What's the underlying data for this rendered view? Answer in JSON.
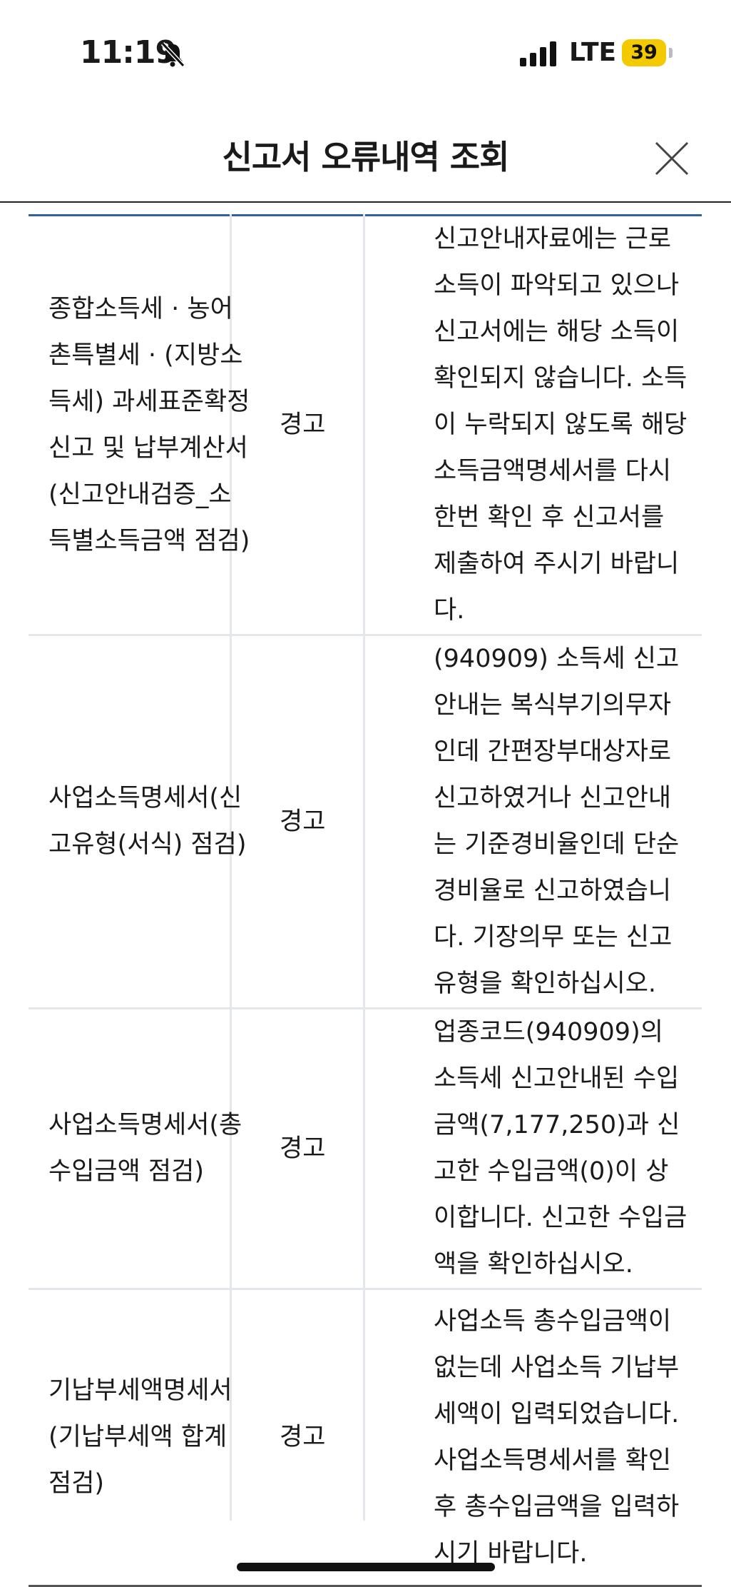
{
  "status_bar": {
    "time": "11:19",
    "network": "LTE",
    "battery": "39"
  },
  "header": {
    "title": "신고서 오류내역 조회"
  },
  "rows": [
    {
      "name": "종합소득세 · 농어촌특별세 · (지방소득세) 과세표준확정 신고 및 납부계산서(신고안내검증_소득별소득금액 점검)",
      "level": "경고",
      "message": "신고안내자료에는 근로소득이 파악되고 있으나 신고서에는 해당 소득이 확인되지 않습니다. 소득이 누락되지 않도록 해당 소득금액명세서를 다시 한번 확인 후 신고서를 제출하여 주시기 바랍니다."
    },
    {
      "name": "사업소득명세서(신고유형(서식) 점검)",
      "level": "경고",
      "message": "(940909) 소득세 신고안내는 복식부기의무자인데 간편장부대상자로 신고하였거나 신고안내는 기준경비율인데 단순경비율로 신고하였습니다. 기장의무 또는 신고유형을 확인하십시오."
    },
    {
      "name": "사업소득명세서(총수입금액 점검)",
      "level": "경고",
      "message": "업종코드(940909)의 소득세 신고안내된 수입금액(7,177,250)과 신고한 수입금액(0)이 상이합니다. 신고한 수입금액을 확인하십시오."
    },
    {
      "name": "기납부세액명세서(기납부세액 합계 점검)",
      "level": "경고",
      "message": "사업소득 총수입금액이 없는데 사업소득 기납부세액이 입력되었습니다. 사업소득명세서를 확인 후 총수입금액을 입력하시기 바랍니다."
    }
  ]
}
